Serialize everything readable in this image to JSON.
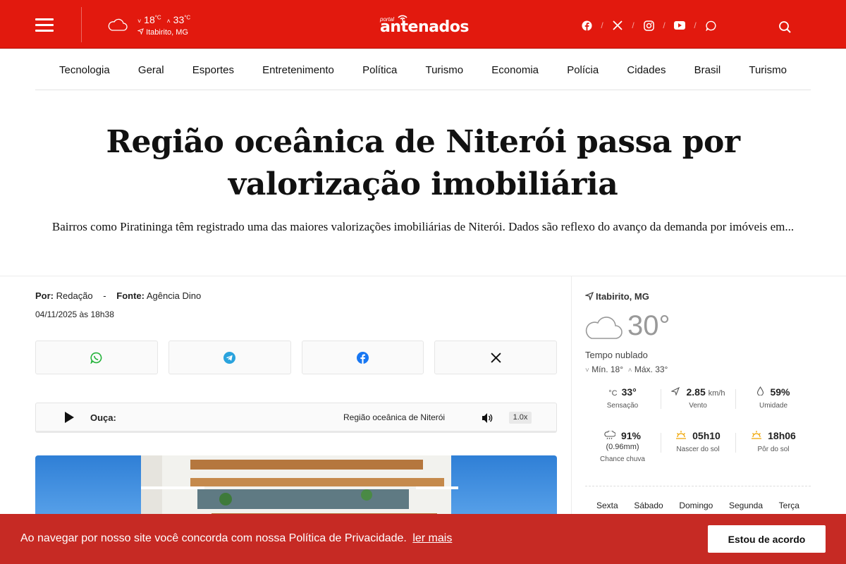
{
  "header": {
    "weather": {
      "min": "18",
      "max": "33",
      "unit": "°C",
      "location": "Itabirito, MG",
      "icon": "cloud-icon"
    },
    "logo": {
      "prefix": "portal",
      "name": "antenados"
    },
    "socials": [
      "facebook-icon",
      "x-icon",
      "instagram-icon",
      "youtube-icon",
      "whatsapp-icon"
    ],
    "search_icon": "search-icon",
    "color": "#e2190e"
  },
  "nav": {
    "items": [
      "Tecnologia",
      "Geral",
      "Esportes",
      "Entretenimento",
      "Política",
      "Turismo",
      "Economia",
      "Polícia",
      "Cidades",
      "Brasil",
      "Turismo"
    ]
  },
  "article": {
    "title": "Região oceânica de Niterói passa por valorização imobiliária",
    "lead": "Bairros como Piratininga têm registrado uma das maiores valorizações imobiliárias de Niterói. Dados são reflexo do avanço da demanda por imóveis em...",
    "author_label": "Por:",
    "author": "Redação",
    "source_label": "Fonte:",
    "source": "Agência Dino",
    "date": "04/11/2025 às 18h38"
  },
  "share": [
    "whatsapp-icon",
    "telegram-icon",
    "facebook-icon",
    "x-icon"
  ],
  "audio": {
    "label": "Ouça:",
    "title": "Região oceânica de Niterói",
    "speed": "1.0x"
  },
  "weather_widget": {
    "location": "Itabirito, MG",
    "temp": "30°",
    "condition": "Tempo nublado",
    "min": "Mín. 18°",
    "max": "Máx. 33°",
    "sensation": {
      "value": "33°",
      "label": "Sensação"
    },
    "wind": {
      "value": "2.85",
      "unit": "km/h",
      "label": "Vento"
    },
    "humidity": {
      "value": "59%",
      "label": "Umidade"
    },
    "rain": {
      "value": "91%",
      "sub": "(0.96mm)",
      "label": "Chance chuva"
    },
    "sunrise": {
      "value": "05h10",
      "label": "Nascer do sol"
    },
    "sunset": {
      "value": "18h06",
      "label": "Pôr do sol"
    },
    "days": [
      "Sexta",
      "Sábado",
      "Domingo",
      "Segunda",
      "Terça"
    ]
  },
  "cookie": {
    "message": "Ao navegar por nosso site você concorda com nossa Política de Privacidade.",
    "link": "ler mais",
    "button": "Estou de acordo"
  }
}
